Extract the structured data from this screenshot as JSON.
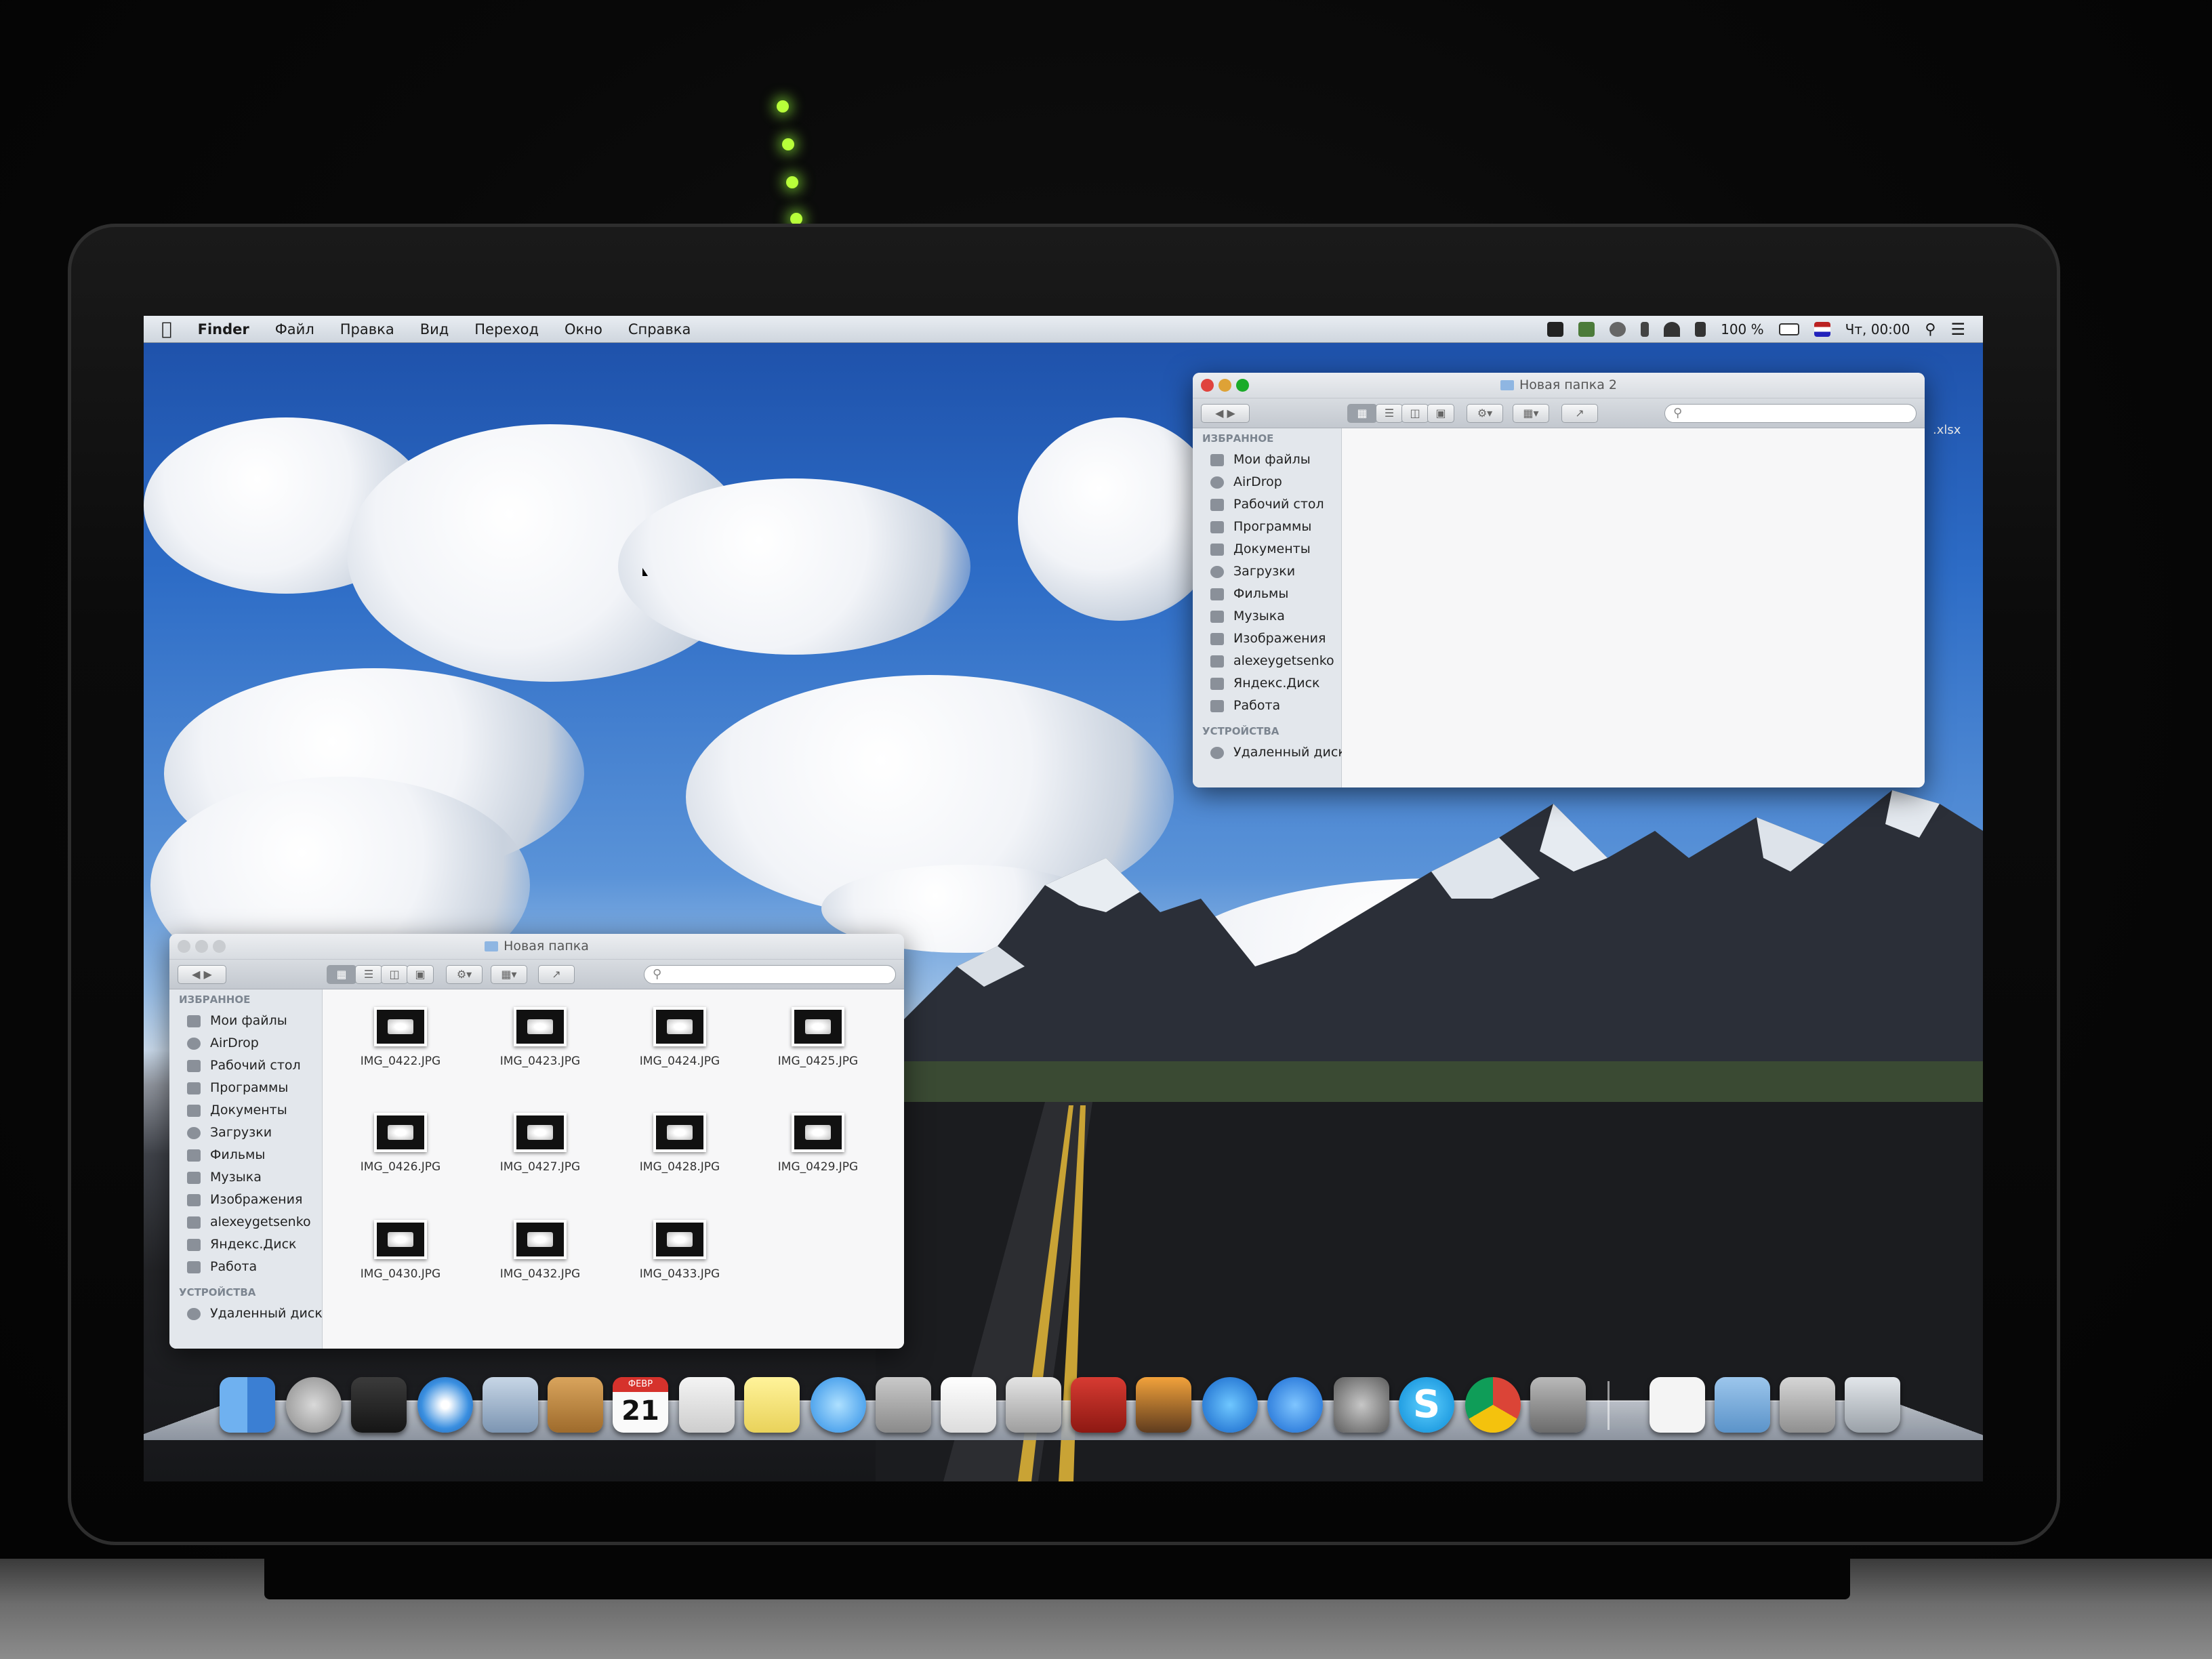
{
  "menubar": {
    "app": "Finder",
    "items": [
      "Файл",
      "Правка",
      "Вид",
      "Переход",
      "Окно",
      "Справка"
    ],
    "status": {
      "battery": "100 %",
      "clock": "Чт, 00:00"
    }
  },
  "window_top": {
    "title": "Новая папка 2",
    "favorites_header": "ИЗБРАННОЕ",
    "favorites": [
      "Мои файлы",
      "AirDrop",
      "Рабочий стол",
      "Программы",
      "Документы",
      "Загрузки",
      "Фильмы",
      "Музыка",
      "Изображения",
      "alexeygetsenko",
      "Яндекс.Диск",
      "Работа"
    ],
    "devices_header": "УСТРОЙСТВА",
    "devices": [
      "Удаленный диск"
    ]
  },
  "window_bottom": {
    "title": "Новая папка",
    "favorites_header": "ИЗБРАННОЕ",
    "favorites": [
      "Мои файлы",
      "AirDrop",
      "Рабочий стол",
      "Программы",
      "Документы",
      "Загрузки",
      "Фильмы",
      "Музыка",
      "Изображения",
      "alexeygetsenko",
      "Яндекс.Диск",
      "Работа"
    ],
    "devices_header": "УСТРОЙСТВА",
    "devices": [
      "Удаленный диск"
    ],
    "files": [
      "IMG_0422.JPG",
      "IMG_0423.JPG",
      "IMG_0424.JPG",
      "IMG_0425.JPG",
      "IMG_0426.JPG",
      "IMG_0427.JPG",
      "IMG_0428.JPG",
      "IMG_0429.JPG",
      "IMG_0430.JPG",
      "IMG_0432.JPG",
      "IMG_0433.JPG"
    ]
  },
  "desktop_fragment": ".xlsx",
  "dock": {
    "calendar_month": "ФЕВР",
    "calendar_day": "21",
    "apps": [
      "finder-icon",
      "launchpad-icon",
      "mission-control-icon",
      "safari-icon",
      "mail-icon",
      "contacts-icon",
      "calendar-icon",
      "reminders-icon",
      "notes-icon",
      "messages-icon",
      "calculator-icon",
      "textedit-icon",
      "facetime-icon",
      "photo-booth-icon",
      "iphoto-icon",
      "itunes-icon",
      "app-store-icon",
      "system-preferences-icon",
      "skype-icon",
      "chrome-icon",
      "joystick-icon",
      "document-icon",
      "folder-icon",
      "screen-icon",
      "trash-icon"
    ]
  },
  "colors": {
    "traffic_red": "#e0443e",
    "traffic_yellow": "#dea236",
    "traffic_green": "#1aab29",
    "sky": "#2d6cc6",
    "led": "#b8ff3a"
  }
}
